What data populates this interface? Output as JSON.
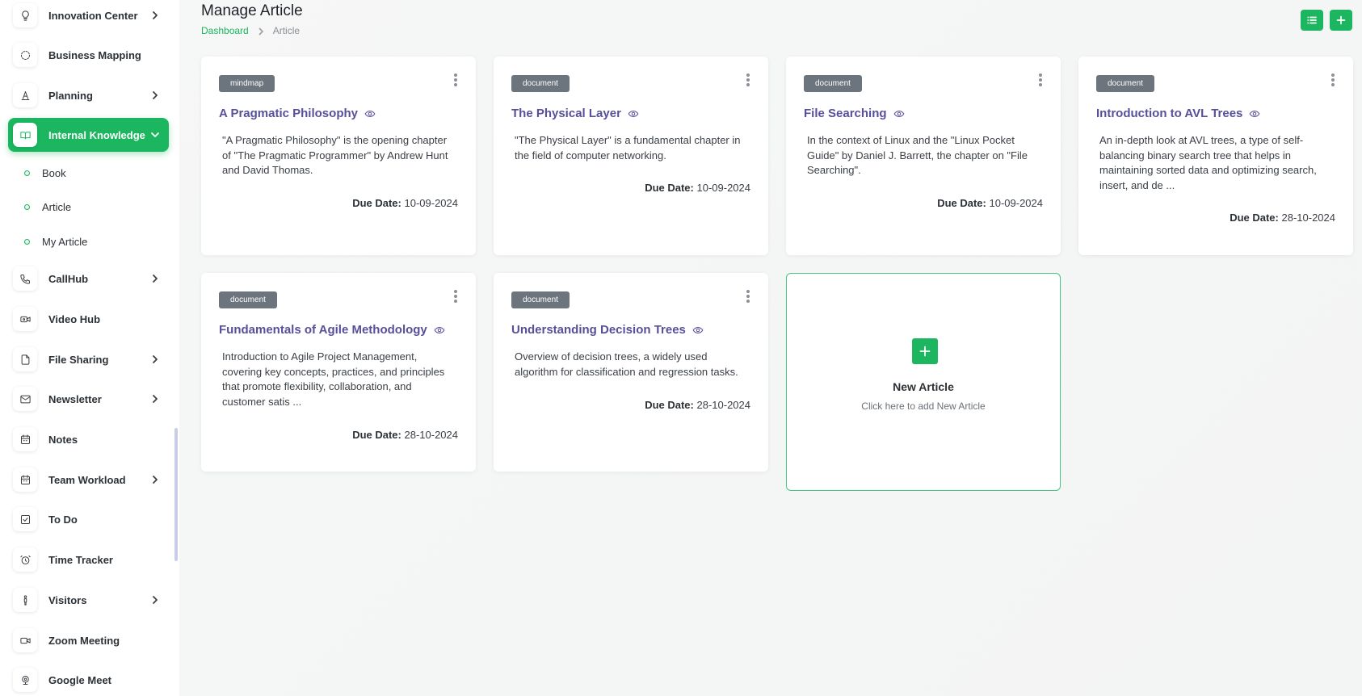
{
  "header": {
    "title": "Manage Article"
  },
  "breadcrumb": {
    "home": "Dashboard",
    "current": "Article"
  },
  "sidebar": {
    "items": [
      {
        "label": "Innovation Center",
        "icon": "lightbulb-icon",
        "chevron": true
      },
      {
        "label": "Business Mapping",
        "icon": "circle-dashed-icon",
        "chevron": false
      },
      {
        "label": "Planning",
        "icon": "pen-tool-icon",
        "chevron": true
      },
      {
        "label": "Internal Knowledge",
        "icon": "book-open-icon",
        "chevron": true,
        "active": true
      },
      {
        "label": "CallHub",
        "icon": "phone-icon",
        "chevron": true
      },
      {
        "label": "Video Hub",
        "icon": "video-icon",
        "chevron": false
      },
      {
        "label": "File Sharing",
        "icon": "file-icon",
        "chevron": true
      },
      {
        "label": "Newsletter",
        "icon": "mail-icon",
        "chevron": true
      },
      {
        "label": "Notes",
        "icon": "calendar-icon",
        "chevron": false
      },
      {
        "label": "Team Workload",
        "icon": "calendar-icon",
        "chevron": true
      },
      {
        "label": "To Do",
        "icon": "checkbox-icon",
        "chevron": false
      },
      {
        "label": "Time Tracker",
        "icon": "alarm-clock-icon",
        "chevron": false
      },
      {
        "label": "Visitors",
        "icon": "person-icon",
        "chevron": true
      },
      {
        "label": "Zoom Meeting",
        "icon": "video-camera-icon",
        "chevron": false
      },
      {
        "label": "Google Meet",
        "icon": "webcam-icon",
        "chevron": false
      }
    ],
    "subitems": [
      {
        "label": "Book"
      },
      {
        "label": "Article"
      },
      {
        "label": "My Article"
      }
    ]
  },
  "articles": [
    {
      "badge": "mindmap",
      "title": "A Pragmatic Philosophy",
      "desc": "\"A Pragmatic Philosophy\" is the opening chapter of \"The Pragmatic Programmer\" by Andrew Hunt and David Thomas.",
      "due_label": "Due Date:",
      "due": "10-09-2024"
    },
    {
      "badge": "document",
      "title": "The Physical Layer",
      "desc": "\"The Physical Layer\" is a fundamental chapter in the field of computer networking.",
      "due_label": "Due Date:",
      "due": "10-09-2024"
    },
    {
      "badge": "document",
      "title": "File Searching",
      "desc": "In the context of Linux and the \"Linux Pocket Guide\" by Daniel J. Barrett, the chapter on \"File Searching\".",
      "due_label": "Due Date:",
      "due": "10-09-2024"
    },
    {
      "badge": "document",
      "title": "Introduction to AVL Trees",
      "desc": "An in-depth look at AVL trees, a type of self-balancing binary search tree that helps in maintaining sorted data and optimizing search, insert, and de ...",
      "due_label": "Due Date:",
      "due": "28-10-2024"
    },
    {
      "badge": "document",
      "title": "Fundamentals of Agile Methodology",
      "desc": "Introduction to Agile Project Management, covering key concepts, practices, and principles that promote flexibility, collaboration, and customer satis ...",
      "due_label": "Due Date:",
      "due": "28-10-2024"
    },
    {
      "badge": "document",
      "title": "Understanding Decision Trees",
      "desc": "Overview of decision trees, a widely used algorithm for classification and regression tasks.",
      "due_label": "Due Date:",
      "due": "28-10-2024"
    }
  ],
  "new_article": {
    "title": "New Article",
    "subtitle": "Click here to add New Article"
  },
  "colors": {
    "accent": "#1bb65f",
    "title": "#574f9a",
    "badge": "#6c757d"
  }
}
